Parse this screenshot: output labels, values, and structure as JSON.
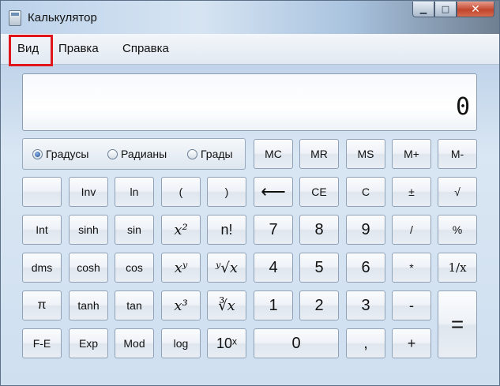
{
  "window": {
    "title": "Калькулятор",
    "minimize_glyph": "▁",
    "maximize_glyph": "□",
    "close_glyph": "✕"
  },
  "menu": {
    "view": "Вид",
    "edit": "Правка",
    "help": "Справка"
  },
  "display": {
    "value": "0"
  },
  "angle_units": {
    "degrees": "Градусы",
    "radians": "Радианы",
    "grads": "Грады",
    "selected": "degrees"
  },
  "keys": {
    "mc": "MC",
    "mr": "MR",
    "ms": "MS",
    "mplus": "M+",
    "mminus": "M-",
    "blank": "",
    "inv": "Inv",
    "ln": "ln",
    "lparen": "(",
    "rparen": ")",
    "backspace": "⟵",
    "ce": "CE",
    "c": "C",
    "plusminus": "±",
    "sqrt": "√",
    "int": "Int",
    "sinh": "sinh",
    "sin": "sin",
    "x2": "x²",
    "fact": "n!",
    "d7": "7",
    "d8": "8",
    "d9": "9",
    "div": "/",
    "percent": "%",
    "dms": "dms",
    "cosh": "cosh",
    "cos": "cos",
    "xy": "xʸ",
    "yroot": "ʸ√x",
    "d4": "4",
    "d5": "5",
    "d6": "6",
    "mul": "*",
    "recip": "1/x",
    "pi": "π",
    "tanh": "tanh",
    "tan": "tan",
    "x3": "x³",
    "cuberoot": "∛x",
    "d1": "1",
    "d2": "2",
    "d3": "3",
    "sub": "-",
    "equals": "=",
    "fe": "F-E",
    "exp": "Exp",
    "mod": "Mod",
    "log": "log",
    "tenx": "10ˣ",
    "d0": "0",
    "dot": ",",
    "add": "+"
  }
}
